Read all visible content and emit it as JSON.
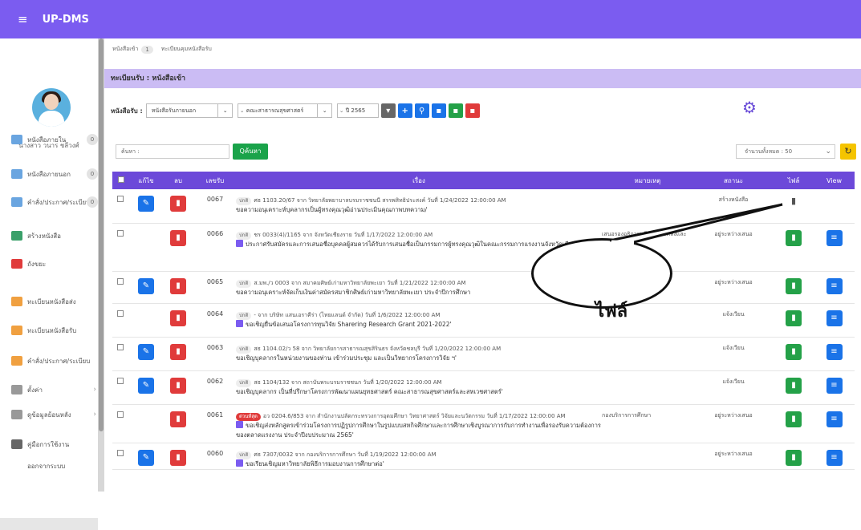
{
  "topbar": {
    "menu": "≡",
    "brand": "UP-DMS"
  },
  "user": {
    "name": "นางสาว วนาร ชลีวงศ์"
  },
  "sidebar": {
    "items": [
      {
        "label": "หนังสือภายใน",
        "count": "0",
        "icon_color": "#6aa5e0"
      },
      {
        "label": "หนังสือภายนอก",
        "count": "0",
        "icon_color": "#6aa5e0"
      },
      {
        "label": "คำสั่ง/ประกาศ/ระเบียบ",
        "count": "0",
        "icon_color": "#6aa5e0"
      },
      {
        "label": "สร้างหนังสือ",
        "icon_color": "#3aa06a"
      },
      {
        "label": "ถังขยะ",
        "icon_color": "#e03b3b"
      },
      {
        "label": "ทะเบียนหนังสือส่ง",
        "icon_color": "#f0a040"
      },
      {
        "label": "ทะเบียนหนังสือรับ",
        "icon_color": "#f0a040"
      },
      {
        "label": "คำสั่ง/ประกาศ/ระเบียบ",
        "icon_color": "#f0a040"
      },
      {
        "label": "ตั้งค่า",
        "chevron": "›",
        "icon_color": "#999999"
      },
      {
        "label": "ดูข้อมูลย้อนหลัง",
        "chevron": "›",
        "icon_color": "#999999"
      },
      {
        "label": "คู่มือการใช้งาน",
        "icon_color": "#666666"
      },
      {
        "label": "ออกจากระบบ",
        "icon_color": "#ffffff"
      }
    ]
  },
  "breadcrumb": {
    "first": "หนังสือเข้า",
    "count": "1",
    "second": "ทะเบียนคุมหนังสือรับ"
  },
  "section_title": "ทะเบียนรับ : หนังสือเข้า",
  "filters": {
    "label": "หนังสือรับ :",
    "type": "หนังสือรับภายนอก",
    "faculty": "คณะสาธารณสุขศาสตร์",
    "year": "ปี 2565"
  },
  "search": {
    "placeholder": "ค้นหา :",
    "button": "Qค้นหา"
  },
  "total": {
    "label": "จำนวนทั้งหมด : 50",
    "chevron": "⌄"
  },
  "table": {
    "headers": [
      "แก้ไข",
      "ลบ",
      "เลขรับ",
      "เรื่อง",
      "หมายเหตุ",
      "สถานะ",
      "ไฟล์",
      "View"
    ],
    "rows": [
      {
        "edit": true,
        "num": "0067",
        "tag": "ปกติ",
        "line1": "ศธ 1103.20/67 จาก วิทยาลัยพยาบาลบรมราชชนนี สรรพสิทธิประสงค์ วันที่ 1/24/2022 12:00:00 AM",
        "line2": "ขอความอนุเคราะห์บุคลากรเป็นผู้ทรงคุณวุฒิอ่านประเมินคุณภาพบทความ/",
        "doc": false,
        "note": "",
        "status": "สร้างหนังสือ",
        "file_state": "grey",
        "view": false
      },
      {
        "edit": false,
        "num": "0066",
        "tag": "ปกติ",
        "line1": "ชร 0033(4)/1165 จาก จังหวัดเชียงราย วันที่ 1/17/2022 12:00:00 AM",
        "line2": "ประกาศรับสมัครและการเสนอชื่อบุคคลผู้สมควรได้รับการเสนอชื่อเป็นกรรมการผู้ทรงคุณวุฒิในคณะกรรมการแรงงานจังหวัดเชียงราย",
        "doc": true,
        "note": "เสนอรองอธิการบดีฝ่ายการคลังและสื่อสารองค์กร",
        "status": "อยู่ระหว่างเสนอ",
        "file_state": "green",
        "view": true
      },
      {
        "edit": true,
        "num": "0065",
        "tag": "ปกติ",
        "line1": "ส.มพ./ว 0003 จาก สมาคมศิษย์เก่ามหาวิทยาลัยพะเยา วันที่ 1/21/2022 12:00:00 AM",
        "line2": "ขอความอนุเคราะห์จัดเก็บเงินค่าสมัครสมาชิกศิษย์เก่ามหาวิทยาลัยพะเยา ประจำปีการศึกษา",
        "doc": false,
        "note": "",
        "status": "อยู่ระหว่างเสนอ",
        "file_state": "green",
        "view": true
      },
      {
        "edit": false,
        "num": "0064",
        "tag": "ปกติ",
        "line1": "- จาก บริษัท แสนเอราคีร่า (ไทยแลนด์ จำกัด) วันที่ 1/6/2022 12:00:00 AM",
        "line2": "ขอเชิญยื่นข้อเสนอโครงการทุนวิจัย Sharering Research Grant 2021-2022'",
        "doc": true,
        "note": "",
        "status": "แจ้งเวียน",
        "file_state": "green",
        "view": true
      },
      {
        "edit": true,
        "num": "0063",
        "tag": "ปกติ",
        "line1": "สธ 1104.02/ว 58 จาก วิทยาลัยการสาธารณสุขสิรินธร จังหวัดชลบุรี วันที่ 1/20/2022 12:00:00 AM",
        "line2": "ขอเชิญบุคลากรในหน่วยงานของท่าน เข้าร่วมประชุม และเป็นวิทยากรโครงการวิจัย ฯ'",
        "doc": false,
        "note": "",
        "status": "แจ้งเวียน",
        "file_state": "green",
        "view": true
      },
      {
        "edit": true,
        "num": "0062",
        "tag": "ปกติ",
        "line1": "สธ 1104/132 จาก สถาบันพระบรมราชชนก วันที่ 1/20/2022 12:00:00 AM",
        "line2": "ขอเชิญบุคลากร เป็นที่ปรึกษาโครงการพัฒนาแผนยุทธศาสตร์ คณะสาธารณสุขศาสตร์และสหเวชศาสตร์'",
        "doc": false,
        "note": "",
        "status": "แจ้งเวียน",
        "file_state": "green",
        "view": true
      },
      {
        "edit": false,
        "num": "0061",
        "tag": "ด่วนที่สุด",
        "tag_red": true,
        "line1": "อว 0204.6/853 จาก สำนักงานปลัดกระทรวงการอุดมศึกษา วิทยาศาสตร์ วิจัยและนวัตกรรม วันที่ 1/17/2022 12:00:00 AM",
        "line2": "ขอเชิญส่งหลักสูตรเข้าร่วมโครงการปฏิรูปการศึกษาในรูปแบบสหกิจศึกษาและการศึกษาเชิงบูรณาการกับการทำงานเพื่อรองรับความต้องการของตลาดแรงงาน ประจำปีงบประมาณ 2565'",
        "doc": true,
        "note": "กองบริการการศึกษา",
        "status": "อยู่ระหว่างเสนอ",
        "file_state": "green",
        "view": true
      },
      {
        "edit": true,
        "num": "0060",
        "tag": "ปกติ",
        "line1": "ศธ 7307/0032 จาก กองบริการการศึกษา วันที่ 1/19/2022 12:00:00 AM",
        "line2": "ขอเรียนเชิญมหาวิทยาลัยพิธีการมอบงานการศึกษาต่อ'",
        "doc": true,
        "note": "",
        "status": "อยู่ระหว่างเสนอ",
        "file_state": "green",
        "view": true
      }
    ]
  },
  "callout": {
    "text": "ไฟล์"
  },
  "colors": {
    "topbar": "#7b5cf0",
    "header": "#6c49d9",
    "section": "#cbbcf4",
    "edit": "#1a73e8",
    "delete": "#e03b3b",
    "file": "#24a148"
  }
}
